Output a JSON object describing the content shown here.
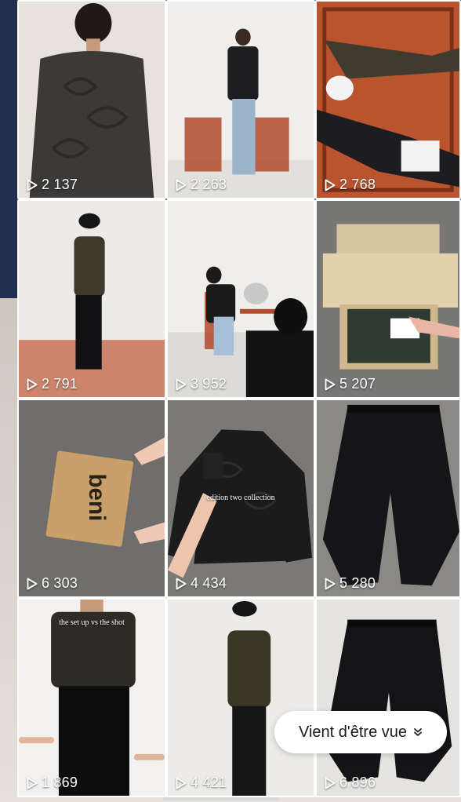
{
  "grid": {
    "tiles": [
      {
        "views": "2 137",
        "scene": "back-of-quilted-jacket",
        "caption": ""
      },
      {
        "views": "2 263",
        "scene": "man-with-leather-jacket-and-chairs",
        "caption": ""
      },
      {
        "views": "2 768",
        "scene": "two-men-lying-on-rug",
        "caption": ""
      },
      {
        "views": "2 791",
        "scene": "man-in-bucket-hat-standing",
        "caption": ""
      },
      {
        "views": "3 952",
        "scene": "photographer-shooting-seated-man",
        "caption": ""
      },
      {
        "views": "5 207",
        "scene": "unboxing-package",
        "caption": ""
      },
      {
        "views": "6 303",
        "scene": "beni-package-held",
        "caption": ""
      },
      {
        "views": "4 434",
        "scene": "leather-jacket-on-floor",
        "caption": "edition two collection"
      },
      {
        "views": "5 280",
        "scene": "dark-trousers-on-floor",
        "caption": ""
      },
      {
        "views": "1 869",
        "scene": "knit-sweater-closeup",
        "caption": "the set up vs the shot"
      },
      {
        "views": "4 421",
        "scene": "man-in-bucket-hat-sweater",
        "caption": ""
      },
      {
        "views": "6 896",
        "scene": "dark-trousers-flat",
        "caption": ""
      }
    ],
    "package_brand": "beni"
  },
  "pill": {
    "label": "Vient d'être vue",
    "icon": "double-chevron-down-icon"
  },
  "colors": {
    "backdrop": "#1f2f4d",
    "pill_bg": "#ffffff",
    "views_text": "#ffffff"
  }
}
